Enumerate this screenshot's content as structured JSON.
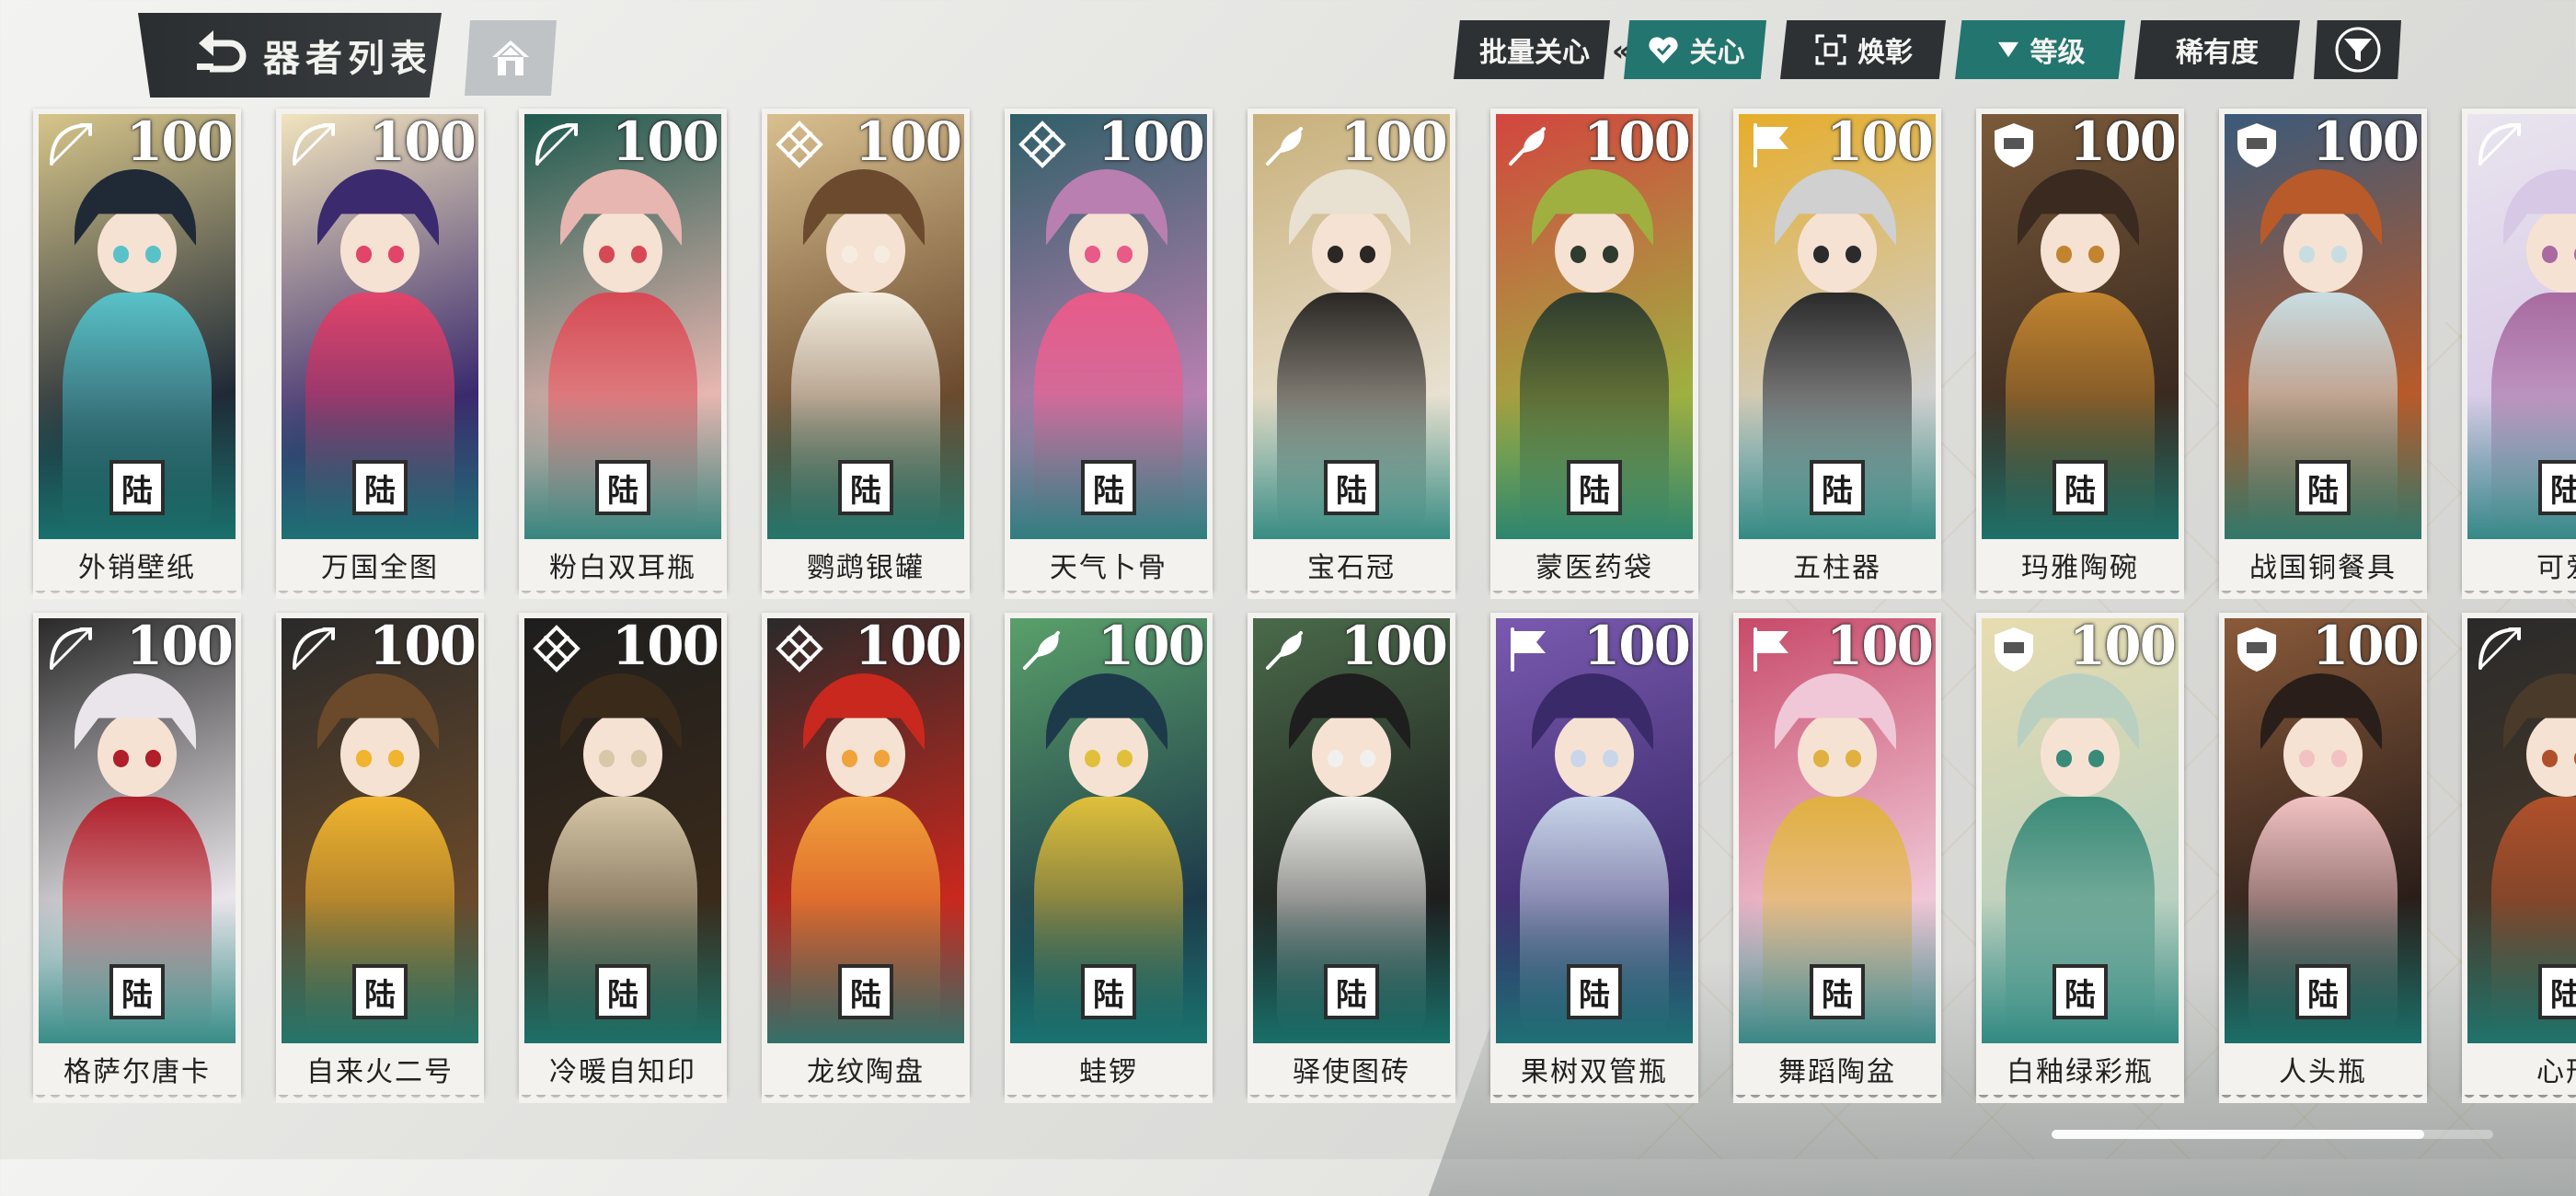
{
  "header": {
    "title": "器者列表",
    "back_icon": "back-arrow-icon",
    "home_icon": "home-icon"
  },
  "toolbar": {
    "batch_label": "批量关心",
    "care_label": "关心",
    "huanzhang_label": "焕彰",
    "level_label": "等级",
    "rarity_label": "稀有度",
    "filter_icon": "filter-icon"
  },
  "colors": {
    "dark": "#2e3133",
    "teal": "#23756f",
    "card_bg": "#f3f2ee"
  },
  "rows": [
    {
      "cards": [
        {
          "name": "外销壁纸",
          "level": "100",
          "seal": "陆",
          "class_icon": "bow-icon"
        },
        {
          "name": "万国全图",
          "level": "100",
          "seal": "陆",
          "class_icon": "bow-icon"
        },
        {
          "name": "粉白双耳瓶",
          "level": "100",
          "seal": "陆",
          "class_icon": "bow-icon"
        },
        {
          "name": "鹦鹉银罐",
          "level": "100",
          "seal": "陆",
          "class_icon": "knot-icon"
        },
        {
          "name": "天气卜骨",
          "level": "100",
          "seal": "陆",
          "class_icon": "knot-icon"
        },
        {
          "name": "宝石冠",
          "level": "100",
          "seal": "陆",
          "class_icon": "feather-icon"
        },
        {
          "name": "蒙医药袋",
          "level": "100",
          "seal": "陆",
          "class_icon": "feather-icon"
        },
        {
          "name": "五柱器",
          "level": "100",
          "seal": "陆",
          "class_icon": "flag-icon"
        },
        {
          "name": "玛雅陶碗",
          "level": "100",
          "seal": "陆",
          "class_icon": "shield-icon"
        },
        {
          "name": "战国铜餐具",
          "level": "100",
          "seal": "陆",
          "class_icon": "shield-icon"
        },
        {
          "name": "可爱",
          "level": "",
          "seal": "陆",
          "class_icon": "bow-icon"
        }
      ]
    },
    {
      "cards": [
        {
          "name": "格萨尔唐卡",
          "level": "100",
          "seal": "陆",
          "class_icon": "bow-icon"
        },
        {
          "name": "自来火二号",
          "level": "100",
          "seal": "陆",
          "class_icon": "bow-icon"
        },
        {
          "name": "冷暖自知印",
          "level": "100",
          "seal": "陆",
          "class_icon": "knot-icon"
        },
        {
          "name": "龙纹陶盘",
          "level": "100",
          "seal": "陆",
          "class_icon": "knot-icon"
        },
        {
          "name": "蛙锣",
          "level": "100",
          "seal": "陆",
          "class_icon": "feather-icon"
        },
        {
          "name": "驿使图砖",
          "level": "100",
          "seal": "陆",
          "class_icon": "feather-icon"
        },
        {
          "name": "果树双管瓶",
          "level": "100",
          "seal": "陆",
          "class_icon": "flag-icon"
        },
        {
          "name": "舞蹈陶盆",
          "level": "100",
          "seal": "陆",
          "class_icon": "flag-icon"
        },
        {
          "name": "白釉绿彩瓶",
          "level": "100",
          "seal": "陆",
          "class_icon": "shield-icon"
        },
        {
          "name": "人头瓶",
          "level": "100",
          "seal": "陆",
          "class_icon": "shield-icon"
        },
        {
          "name": "心形",
          "level": "",
          "seal": "陆",
          "class_icon": "bow-icon"
        }
      ]
    }
  ]
}
